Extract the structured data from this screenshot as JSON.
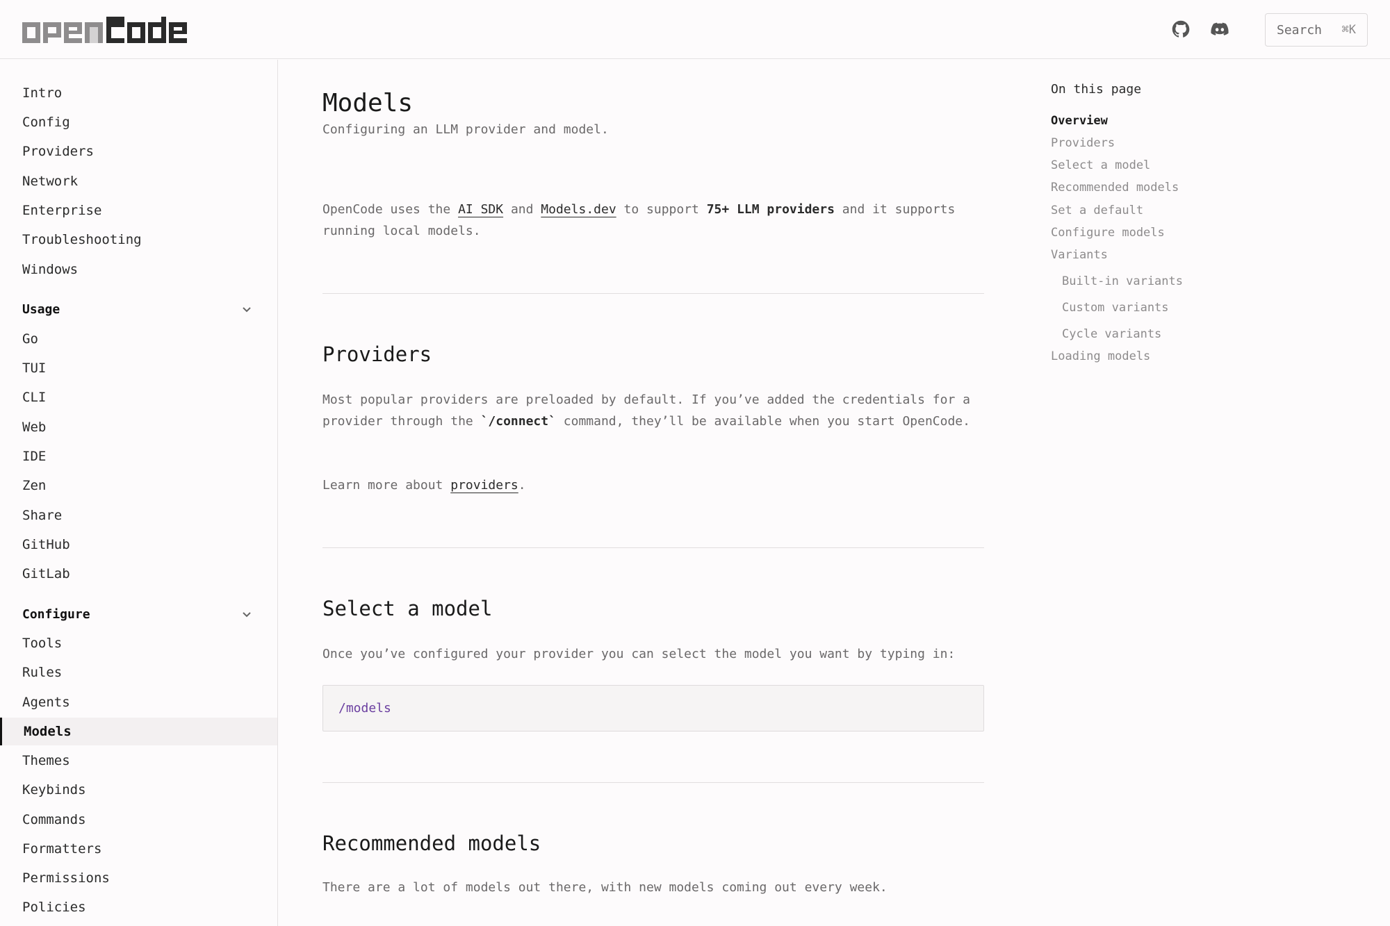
{
  "header": {
    "brand": "opencode",
    "search_label": "Search",
    "search_shortcut": "⌘K",
    "icons": [
      "github-icon",
      "discord-icon"
    ]
  },
  "sidebar": {
    "items_top": [
      {
        "label": "Intro"
      },
      {
        "label": "Config"
      },
      {
        "label": "Providers"
      },
      {
        "label": "Network"
      },
      {
        "label": "Enterprise"
      },
      {
        "label": "Troubleshooting"
      },
      {
        "label": "Windows"
      }
    ],
    "group_usage": {
      "label": "Usage",
      "items": [
        {
          "label": "Go"
        },
        {
          "label": "TUI"
        },
        {
          "label": "CLI"
        },
        {
          "label": "Web"
        },
        {
          "label": "IDE"
        },
        {
          "label": "Zen"
        },
        {
          "label": "Share"
        },
        {
          "label": "GitHub"
        },
        {
          "label": "GitLab"
        }
      ]
    },
    "group_configure": {
      "label": "Configure",
      "items": [
        {
          "label": "Tools"
        },
        {
          "label": "Rules"
        },
        {
          "label": "Agents"
        },
        {
          "label": "Models",
          "active": true
        },
        {
          "label": "Themes"
        },
        {
          "label": "Keybinds"
        },
        {
          "label": "Commands"
        },
        {
          "label": "Formatters"
        },
        {
          "label": "Permissions"
        },
        {
          "label": "Policies"
        }
      ]
    }
  },
  "main": {
    "title": "Models",
    "subtitle": "Configuring an LLM provider and model.",
    "intro": {
      "t1": "OpenCode uses the ",
      "link1": "AI SDK",
      "t2": " and ",
      "link2": "Models.dev",
      "t3": " to support ",
      "strong": "75+ LLM providers",
      "t4": " and it supports running local models."
    },
    "providers": {
      "heading": "Providers",
      "p1_a": "Most popular providers are preloaded by default. If you’ve added the credentials for a provider through the ",
      "p1_code": "`/connect`",
      "p1_b": " command, they’ll be available when you start OpenCode.",
      "p2_a": "Learn more about ",
      "p2_link": "providers",
      "p2_b": "."
    },
    "select_model": {
      "heading": "Select a model",
      "text": "Once you’ve configured your provider you can select the model you want by typing in:",
      "code": "/models"
    },
    "recommended": {
      "heading": "Recommended models",
      "text": "There are a lot of models out there, with new models coming out every week."
    }
  },
  "toc": {
    "title": "On this page",
    "items": [
      {
        "label": "Overview",
        "active": true
      },
      {
        "label": "Providers"
      },
      {
        "label": "Select a model"
      },
      {
        "label": "Recommended models"
      },
      {
        "label": "Set a default"
      },
      {
        "label": "Configure models"
      },
      {
        "label": "Variants"
      },
      {
        "label": "Built-in variants",
        "sub": true
      },
      {
        "label": "Custom variants",
        "sub": true
      },
      {
        "label": "Cycle variants",
        "sub": true
      },
      {
        "label": "Loading models"
      }
    ]
  },
  "colors": {
    "background": "#fdfbfc",
    "text": "#2b2b2b",
    "muted": "#6a6869",
    "code_accent": "#6b3fa0",
    "border": "#e4e1e2"
  }
}
